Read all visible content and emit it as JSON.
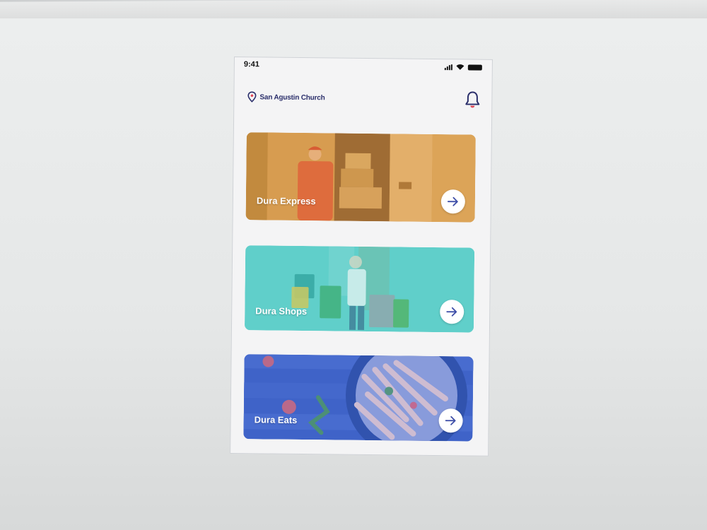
{
  "status_bar": {
    "time": "9:41",
    "icons": [
      "signal-icon",
      "wifi-icon",
      "battery-icon"
    ]
  },
  "header": {
    "location_label": "San Agustin Church",
    "location_icon": "location-pin-icon",
    "notification_icon": "bell-icon"
  },
  "services": [
    {
      "label": "Dura Express",
      "icon": "arrow-right-icon",
      "tint": "#e0a24a"
    },
    {
      "label": "Dura Shops",
      "icon": "arrow-right-icon",
      "tint": "#5fcfcb"
    },
    {
      "label": "Dura Eats",
      "icon": "arrow-right-icon",
      "tint": "#3f63c9"
    }
  ],
  "colors": {
    "accent": "#2b2f6b",
    "bell_accent": "#e04b5a",
    "express": "#e0a24a",
    "shops": "#5fcfcb",
    "eats": "#3f63c9"
  }
}
